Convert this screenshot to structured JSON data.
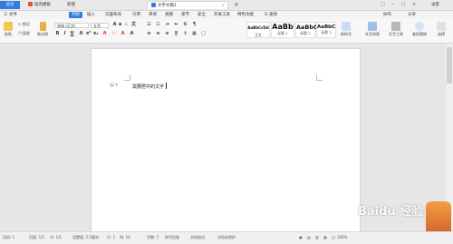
{
  "tabs": {
    "home": "首页",
    "dh": "稻壳模板",
    "new": "新建",
    "doc": "文字文稿1"
  },
  "window": {
    "login": "访客"
  },
  "menubar": {
    "file": "三 文件",
    "start": "开始",
    "insert": "插入",
    "layout": "页面布局",
    "ref": "引用",
    "review": "审阅",
    "view": "视图",
    "section": "章节",
    "security": "安全",
    "dev": "开发工具",
    "special": "特色功能",
    "search": "Q 查找",
    "collab": "协作",
    "share": "分享"
  },
  "ribbon": {
    "paste": "粘贴",
    "cut": "剪切",
    "copy": "复制",
    "formatpainter": "格式刷",
    "font_name": "宋体 (正文)",
    "font_size": "五号",
    "styles": [
      {
        "preview": "AaBbCcDd",
        "name": "正文"
      },
      {
        "preview": "AaBb",
        "name": "标题 1"
      },
      {
        "preview": "AaBbC",
        "name": "标题 2"
      },
      {
        "preview": "AaBbC",
        "name": "标题 3"
      }
    ],
    "newstyle": "新样式",
    "textassist": "文字排版",
    "textformat": "文字工具",
    "findreplace": "查找替换",
    "select": "选择"
  },
  "document": {
    "text": "需要居中的文字"
  },
  "status": {
    "page": "页码: 1",
    "pages": "页面: 1/1",
    "section": "节: 1/1",
    "setting": "设置值: 2.5厘米",
    "row": "行: 1",
    "col": "列: 10",
    "words": "字数: 7",
    "spell": "拼写检查",
    "compare": "文档校对",
    "protect": "文档未保护",
    "zoom": "100%"
  },
  "watermark": "Baidu 经验",
  "colors": {
    "accent": "#2f7de1",
    "page": "#ffffff",
    "bg": "#e6e6e6"
  },
  "icons": [
    "search-icon",
    "paste-icon",
    "scissors-icon",
    "copy-icon",
    "brush-icon",
    "bold-icon",
    "italic-icon",
    "underline-icon"
  ]
}
